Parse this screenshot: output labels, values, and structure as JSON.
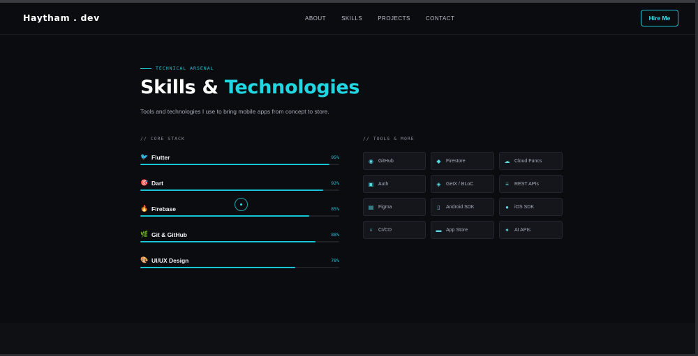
{
  "header": {
    "logo": "Haytham . dev",
    "nav": [
      "ABOUT",
      "SKILLS",
      "PROJECTS",
      "CONTACT"
    ],
    "cta": "Hire Me"
  },
  "hero": {
    "eyebrow": "TECHNICAL ARSENAL",
    "title_white": "Skills & ",
    "title_cyan": "Technologies",
    "subtitle": "Tools and technologies I use to bring mobile apps from concept to store."
  },
  "core": {
    "label": "// CORE STACK",
    "skills": [
      {
        "icon": "🐦",
        "icon_name": "flutter-icon",
        "name": "Flutter",
        "pct_label": "95%",
        "level": 0.95
      },
      {
        "icon": "🎯",
        "icon_name": "dart-icon",
        "name": "Dart",
        "pct_label": "92%",
        "level": 0.92
      },
      {
        "icon": "🔥",
        "icon_name": "firebase-icon",
        "name": "Firebase",
        "pct_label": "85%",
        "level": 0.85
      },
      {
        "icon": "🌿",
        "icon_name": "git-icon",
        "name": "Git & GitHub",
        "pct_label": "88%",
        "level": 0.88
      },
      {
        "icon": "🎨",
        "icon_name": "palette-icon",
        "name": "UI/UX Design",
        "pct_label": "78%",
        "level": 0.78
      }
    ]
  },
  "tools": {
    "label": "// TOOLS & MORE",
    "items": [
      {
        "icon": "◉",
        "icon_name": "github-icon",
        "label": "GitHub"
      },
      {
        "icon": "◆",
        "icon_name": "flame-icon",
        "label": "Firestore"
      },
      {
        "icon": "☁",
        "icon_name": "cloud-icon",
        "label": "Cloud Funcs"
      },
      {
        "icon": "▣",
        "icon_name": "lock-icon",
        "label": "Auth"
      },
      {
        "icon": "◈",
        "icon_name": "layers-icon",
        "label": "GetX / BLoC"
      },
      {
        "icon": "≡",
        "icon_name": "database-icon",
        "label": "REST APIs"
      },
      {
        "icon": "▤",
        "icon_name": "figma-icon",
        "label": "Figma"
      },
      {
        "icon": "▯",
        "icon_name": "phone-icon",
        "label": "Android SDK"
      },
      {
        "icon": "●",
        "icon_name": "apple-icon",
        "label": "iOS SDK"
      },
      {
        "icon": "⑂",
        "icon_name": "branch-icon",
        "label": "CI/CD"
      },
      {
        "icon": "▬",
        "icon_name": "store-icon",
        "label": "App Store"
      },
      {
        "icon": "✦",
        "icon_name": "robot-icon",
        "label": "AI APIs"
      }
    ]
  },
  "colors": {
    "accent": "#19c7d6",
    "background": "#0b0c10",
    "card": "#14161c"
  }
}
